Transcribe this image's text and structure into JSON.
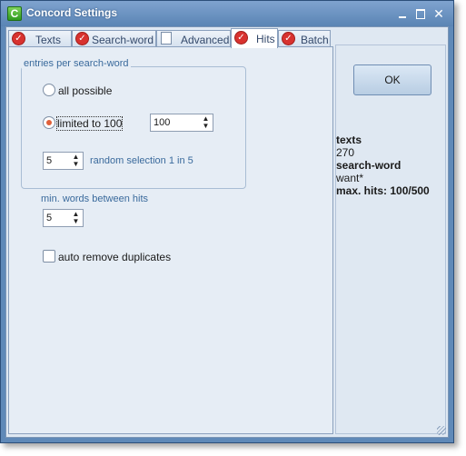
{
  "window": {
    "title": "Concord Settings",
    "app_icon_letter": "C"
  },
  "tabs": [
    {
      "label": "Texts",
      "indicator": "check"
    },
    {
      "label": "Search-word",
      "indicator": "check"
    },
    {
      "label": "Advanced",
      "indicator": "box"
    },
    {
      "label": "Hits",
      "indicator": "check",
      "active": true
    },
    {
      "label": "Batch",
      "indicator": "check"
    }
  ],
  "hits_panel": {
    "group_label": "entries per search-word",
    "all_possible_label": "all possible",
    "limited_label": "limited to 100",
    "limited_value": "100",
    "random_value": "5",
    "random_label": "random selection 1 in 5",
    "min_words_label": "min. words between hits",
    "min_words_value": "5",
    "auto_remove_label": "auto remove duplicates",
    "selected_option": "limited",
    "auto_remove_checked": false
  },
  "right_panel": {
    "ok_label": "OK",
    "texts_heading": "texts",
    "texts_value": "270",
    "search_heading": "search-word",
    "search_value": "want*",
    "max_hits": "max. hits: 100/500"
  },
  "colors": {
    "accent": "#5f89b8",
    "check_red": "#d8322f",
    "radio_selected": "#e0603a",
    "label_blue": "#3a6a9c"
  }
}
